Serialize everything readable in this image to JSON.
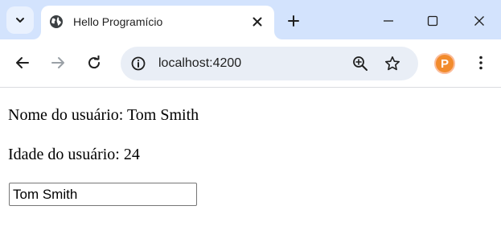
{
  "browser": {
    "tab": {
      "title": "Hello Programício",
      "favicon": "globe-icon"
    },
    "new_tab_label": "+",
    "toolbar": {
      "url": "localhost:4200",
      "profile_initial": "P"
    },
    "colors": {
      "tabstrip": "#d3e3fd",
      "omnibox": "#e9eef6",
      "profile": "#f28b2c"
    }
  },
  "page": {
    "user_name_line": "Nome do usuário: Tom Smith",
    "user_age_line": "Idade do usuário: 24",
    "name_input_value": "Tom Smith"
  }
}
